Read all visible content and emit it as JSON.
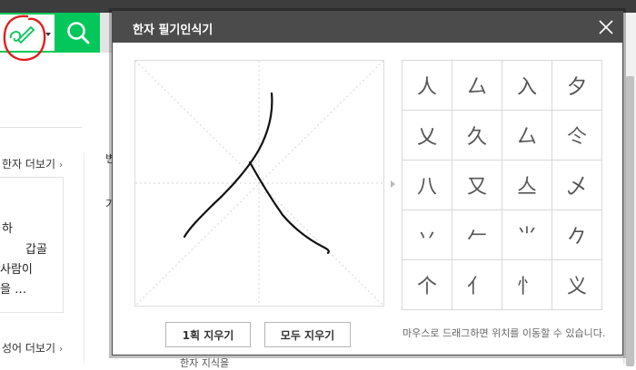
{
  "background": {
    "more_hanja": "한자 더보기",
    "more_idiom": "성어 더보기",
    "more_arrow": "›",
    "word_lines": [
      "하",
      "갑골",
      "사람이",
      "을 …"
    ],
    "bottom_text": "한자 지식을",
    "partial_1": "변",
    "partial_2": "기",
    "colors": {
      "search_green": "#03c75a",
      "annotation_red": "#e02020"
    }
  },
  "modal": {
    "title": "한자 필기인식기",
    "candidates": [
      "人",
      "厶",
      "入",
      "夕",
      "乂",
      "久",
      "厶",
      "仒",
      "八",
      "又",
      "亼",
      "乄",
      "丷",
      "𠂉",
      "⺌",
      "𠂊",
      "个",
      "亻",
      "忄",
      "义"
    ],
    "clear_one_label": "1획 지우기",
    "clear_all_label": "모두 지우기",
    "drag_hint": "마우스로 드래그하면 위치를 이동할 수 있습니다.",
    "icons": {
      "close": "close-icon",
      "side": "arrow-right-icon"
    }
  }
}
